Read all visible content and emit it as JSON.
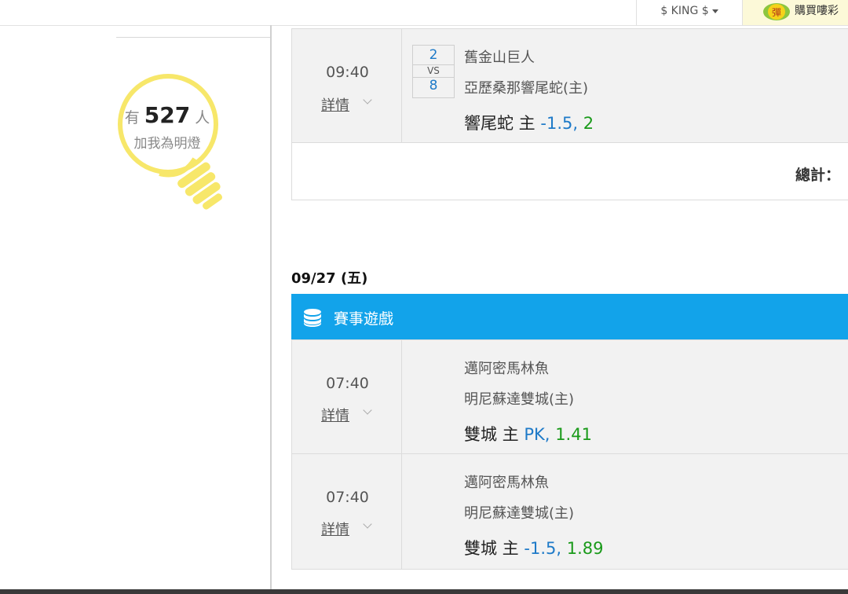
{
  "topbar": {
    "user_menu": "$ KING $",
    "buy_badge": "彈",
    "buy_label": "購買嘍彩"
  },
  "fan_panel": {
    "prefix": "有",
    "count": "527",
    "suffix": "人",
    "subtitle": "加我為明燈"
  },
  "matches_top": [
    {
      "time": "09:40",
      "detail_label": "詳情",
      "score_away": "2",
      "vs_label": "VS",
      "score_home": "8",
      "away_team": "舊金山巨人",
      "home_team": "亞歷桑那響尾蛇(主)",
      "pick_team": "響尾蛇 主",
      "pick_line": "-1.5,",
      "pick_odds": "2"
    }
  ],
  "total_label": "總計：",
  "section": {
    "date": "09/27 (五)",
    "title": "賽事遊戲",
    "icon": "coin-stack-icon"
  },
  "matches": [
    {
      "time": "07:40",
      "detail_label": "詳情",
      "away_team": "邁阿密馬林魚",
      "home_team": "明尼蘇達雙城(主)",
      "pick_team": "雙城 主",
      "pick_line": "PK,",
      "pick_odds": "1.41"
    },
    {
      "time": "07:40",
      "detail_label": "詳情",
      "away_team": "邁阿密馬林魚",
      "home_team": "明尼蘇達雙城(主)",
      "pick_team": "雙城 主",
      "pick_line": "-1.5,",
      "pick_odds": "1.89"
    }
  ],
  "colors": {
    "section_bar": "#12a3ea",
    "line_blue": "#1e7ac8",
    "odds_green": "#1a9a1a",
    "bulb_yellow": "#f7e76a"
  }
}
